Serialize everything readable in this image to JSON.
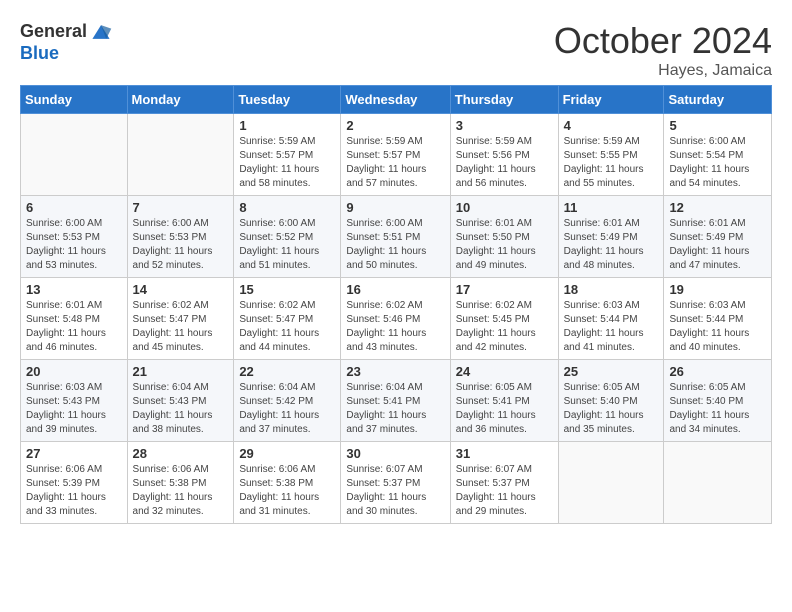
{
  "header": {
    "logo_general": "General",
    "logo_blue": "Blue",
    "month_title": "October 2024",
    "location": "Hayes, Jamaica"
  },
  "calendar": {
    "days_of_week": [
      "Sunday",
      "Monday",
      "Tuesday",
      "Wednesday",
      "Thursday",
      "Friday",
      "Saturday"
    ],
    "weeks": [
      [
        {
          "day": "",
          "info": ""
        },
        {
          "day": "",
          "info": ""
        },
        {
          "day": "1",
          "info": "Sunrise: 5:59 AM\nSunset: 5:57 PM\nDaylight: 11 hours and 58 minutes."
        },
        {
          "day": "2",
          "info": "Sunrise: 5:59 AM\nSunset: 5:57 PM\nDaylight: 11 hours and 57 minutes."
        },
        {
          "day": "3",
          "info": "Sunrise: 5:59 AM\nSunset: 5:56 PM\nDaylight: 11 hours and 56 minutes."
        },
        {
          "day": "4",
          "info": "Sunrise: 5:59 AM\nSunset: 5:55 PM\nDaylight: 11 hours and 55 minutes."
        },
        {
          "day": "5",
          "info": "Sunrise: 6:00 AM\nSunset: 5:54 PM\nDaylight: 11 hours and 54 minutes."
        }
      ],
      [
        {
          "day": "6",
          "info": "Sunrise: 6:00 AM\nSunset: 5:53 PM\nDaylight: 11 hours and 53 minutes."
        },
        {
          "day": "7",
          "info": "Sunrise: 6:00 AM\nSunset: 5:53 PM\nDaylight: 11 hours and 52 minutes."
        },
        {
          "day": "8",
          "info": "Sunrise: 6:00 AM\nSunset: 5:52 PM\nDaylight: 11 hours and 51 minutes."
        },
        {
          "day": "9",
          "info": "Sunrise: 6:00 AM\nSunset: 5:51 PM\nDaylight: 11 hours and 50 minutes."
        },
        {
          "day": "10",
          "info": "Sunrise: 6:01 AM\nSunset: 5:50 PM\nDaylight: 11 hours and 49 minutes."
        },
        {
          "day": "11",
          "info": "Sunrise: 6:01 AM\nSunset: 5:49 PM\nDaylight: 11 hours and 48 minutes."
        },
        {
          "day": "12",
          "info": "Sunrise: 6:01 AM\nSunset: 5:49 PM\nDaylight: 11 hours and 47 minutes."
        }
      ],
      [
        {
          "day": "13",
          "info": "Sunrise: 6:01 AM\nSunset: 5:48 PM\nDaylight: 11 hours and 46 minutes."
        },
        {
          "day": "14",
          "info": "Sunrise: 6:02 AM\nSunset: 5:47 PM\nDaylight: 11 hours and 45 minutes."
        },
        {
          "day": "15",
          "info": "Sunrise: 6:02 AM\nSunset: 5:47 PM\nDaylight: 11 hours and 44 minutes."
        },
        {
          "day": "16",
          "info": "Sunrise: 6:02 AM\nSunset: 5:46 PM\nDaylight: 11 hours and 43 minutes."
        },
        {
          "day": "17",
          "info": "Sunrise: 6:02 AM\nSunset: 5:45 PM\nDaylight: 11 hours and 42 minutes."
        },
        {
          "day": "18",
          "info": "Sunrise: 6:03 AM\nSunset: 5:44 PM\nDaylight: 11 hours and 41 minutes."
        },
        {
          "day": "19",
          "info": "Sunrise: 6:03 AM\nSunset: 5:44 PM\nDaylight: 11 hours and 40 minutes."
        }
      ],
      [
        {
          "day": "20",
          "info": "Sunrise: 6:03 AM\nSunset: 5:43 PM\nDaylight: 11 hours and 39 minutes."
        },
        {
          "day": "21",
          "info": "Sunrise: 6:04 AM\nSunset: 5:43 PM\nDaylight: 11 hours and 38 minutes."
        },
        {
          "day": "22",
          "info": "Sunrise: 6:04 AM\nSunset: 5:42 PM\nDaylight: 11 hours and 37 minutes."
        },
        {
          "day": "23",
          "info": "Sunrise: 6:04 AM\nSunset: 5:41 PM\nDaylight: 11 hours and 37 minutes."
        },
        {
          "day": "24",
          "info": "Sunrise: 6:05 AM\nSunset: 5:41 PM\nDaylight: 11 hours and 36 minutes."
        },
        {
          "day": "25",
          "info": "Sunrise: 6:05 AM\nSunset: 5:40 PM\nDaylight: 11 hours and 35 minutes."
        },
        {
          "day": "26",
          "info": "Sunrise: 6:05 AM\nSunset: 5:40 PM\nDaylight: 11 hours and 34 minutes."
        }
      ],
      [
        {
          "day": "27",
          "info": "Sunrise: 6:06 AM\nSunset: 5:39 PM\nDaylight: 11 hours and 33 minutes."
        },
        {
          "day": "28",
          "info": "Sunrise: 6:06 AM\nSunset: 5:38 PM\nDaylight: 11 hours and 32 minutes."
        },
        {
          "day": "29",
          "info": "Sunrise: 6:06 AM\nSunset: 5:38 PM\nDaylight: 11 hours and 31 minutes."
        },
        {
          "day": "30",
          "info": "Sunrise: 6:07 AM\nSunset: 5:37 PM\nDaylight: 11 hours and 30 minutes."
        },
        {
          "day": "31",
          "info": "Sunrise: 6:07 AM\nSunset: 5:37 PM\nDaylight: 11 hours and 29 minutes."
        },
        {
          "day": "",
          "info": ""
        },
        {
          "day": "",
          "info": ""
        }
      ]
    ]
  }
}
